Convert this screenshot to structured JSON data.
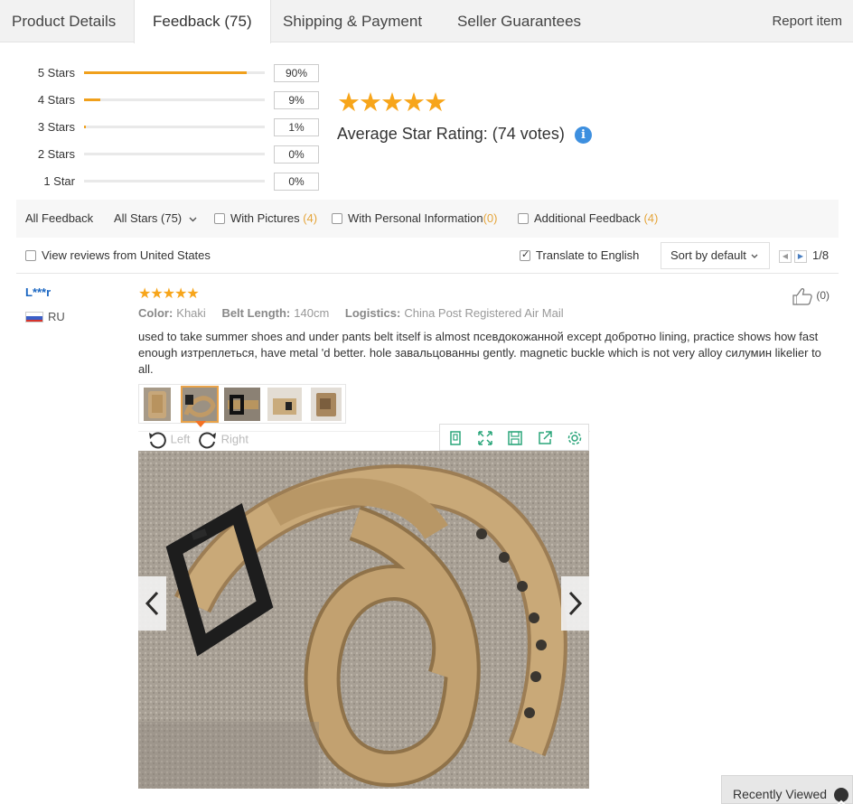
{
  "tabs": [
    {
      "label": "Product Details"
    },
    {
      "label": "Feedback (75)"
    },
    {
      "label": "Shipping & Payment"
    },
    {
      "label": "Seller Guarantees"
    }
  ],
  "report_label": "Report item",
  "ratings": [
    {
      "label": "5 Stars",
      "percent_text": "90%",
      "fraction": 0.9
    },
    {
      "label": "4 Stars",
      "percent_text": "9%",
      "fraction": 0.09
    },
    {
      "label": "3 Stars",
      "percent_text": "1%",
      "fraction": 0.01
    },
    {
      "label": "2 Stars",
      "percent_text": "0%",
      "fraction": 0
    },
    {
      "label": "1 Star",
      "percent_text": "0%",
      "fraction": 0
    }
  ],
  "average": {
    "stars_text": "★★★★★",
    "label": "Average Star Rating:",
    "votes": "(74 votes)"
  },
  "filters": {
    "all_feedback": "All Feedback",
    "all_stars": "All Stars (75)",
    "with_pictures": "With Pictures",
    "with_pictures_count": "(4)",
    "with_personal": "With Personal Information",
    "with_personal_count": "(0)",
    "additional": "Additional Feedback",
    "additional_count": "(4)",
    "view_us": "View reviews from United States",
    "translate": "Translate to English",
    "sort": "Sort by default",
    "page": "1/8"
  },
  "review": {
    "user": "L***r",
    "country": "RU",
    "stars_text": "★★★★★",
    "helpful": "(0)",
    "color_label": "Color:",
    "color_value": "Khaki",
    "length_label": "Belt Length:",
    "length_value": "140cm",
    "logistics_label": "Logistics:",
    "logistics_value": "China Post Registered Air Mail",
    "text": "used to take summer shoes and under pants belt itself is almost псевдокожанной except добротно lining, practice shows how fast enough изтреплеться, have metal 'd better. hole завальцованны gently. magnetic buckle which is not very alloy силумин likelier to all.",
    "rotate_left": "Left",
    "rotate_right": "Right"
  },
  "recently_viewed": "Recently Viewed",
  "colors": {
    "accent_orange": "#f0a01c",
    "star": "#f7a51a",
    "link_blue": "#1a66c2"
  }
}
